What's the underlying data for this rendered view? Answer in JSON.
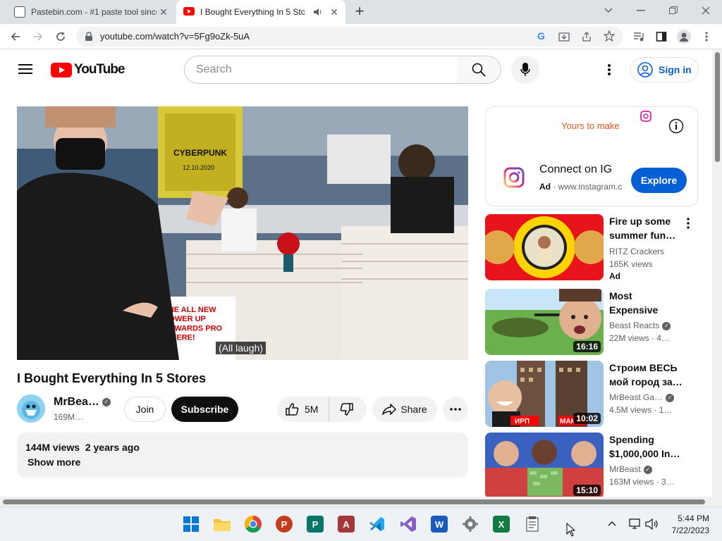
{
  "browser": {
    "tabs": [
      {
        "title": "Pastebin.com - #1 paste tool since 2002!",
        "active": false
      },
      {
        "title": "I Bought Everything In 5 Stores",
        "active": true
      }
    ],
    "new_tab_symbol": "+",
    "url": "youtube.com/watch?v=5Fg9oZk-5uA"
  },
  "youtube": {
    "logo_text": "YouTube",
    "search_placeholder": "Search",
    "sign_in_label": "Sign in"
  },
  "video": {
    "caption": "(All laugh)",
    "title": "I Bought Everything In 5 Stores",
    "channel": "MrBea…",
    "subscribers": "169M…",
    "join_label": "Join",
    "subscribe_label": "Subscribe",
    "likes": "5M",
    "share_label": "Share",
    "views": "144M views",
    "age": "2 years ago",
    "show_more_label": "Show more",
    "overlay_text_1": "CYBERPUNK",
    "overlay_text_2": "12.10.2020",
    "overlay_text_3": "THE ALL NEW\nPOWER UP\nREWARDS PRO\nS HERE!"
  },
  "ad": {
    "banner_text": "Yours to make",
    "title": "Connect on IG",
    "badge": "Ad",
    "domain": "www.instagram.c",
    "cta": "Explore"
  },
  "recommendations": [
    {
      "title": "Fire up some summer fun…",
      "channel": "RITZ Crackers",
      "verified": false,
      "views": "165K views",
      "extra": "Ad",
      "duration": ""
    },
    {
      "title": "Most Expensive Fails!",
      "channel": "Beast Reacts",
      "verified": true,
      "views": "22M views · 4…",
      "extra": "",
      "duration": "16:16"
    },
    {
      "title": "Строим ВЕСЬ мой город за…",
      "channel": "MrBeast Ga…",
      "verified": true,
      "views": "4.5M views · 1…",
      "extra": "",
      "duration": "10:02",
      "thumb_labels": [
        "ИРП",
        "МАК"
      ]
    },
    {
      "title": "Spending $1,000,000 In…",
      "channel": "MrBeast",
      "verified": true,
      "views": "163M views · 3…",
      "extra": "",
      "duration": "15:10"
    }
  ],
  "taskbar": {
    "time": "5:44 PM",
    "date": "7/22/2023"
  }
}
